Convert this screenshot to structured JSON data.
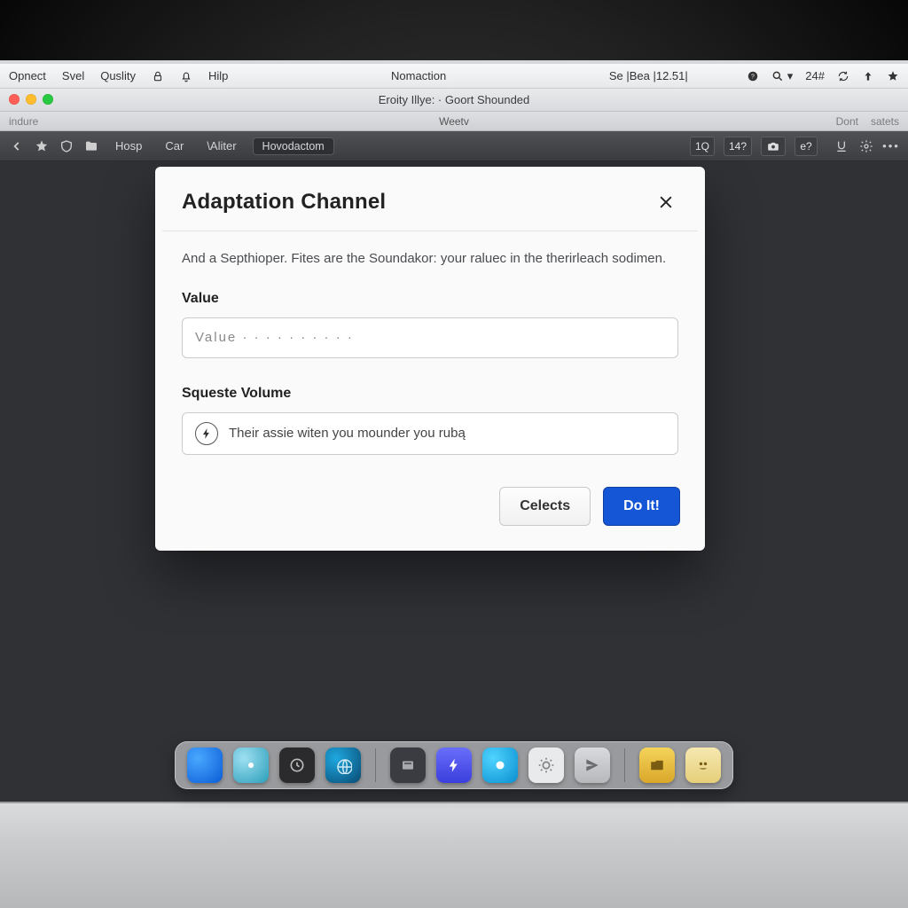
{
  "menubar": {
    "items": [
      "Opnect",
      "Svel",
      "Quslity",
      "Hilp"
    ],
    "center": "Nomaction",
    "status": "Se |Bea |12.51|",
    "clock": "24#"
  },
  "window": {
    "title": "Eroity Illye: · Goort Shounded",
    "subtitle": "Weetv",
    "sub_left": "indure",
    "sub_right": [
      "Dont",
      "satets"
    ]
  },
  "toolbar": {
    "items": [
      "Hosp",
      "Car",
      "\\Aliter"
    ],
    "pill": "Hovodactom",
    "chips": [
      "1Q",
      "14?",
      "e?"
    ]
  },
  "modal": {
    "title": "Adaptation Channel",
    "description": "And a Septhioper. Fites are the Soundakor: your raluec in the therirleach sodimen.",
    "field1_label": "Value",
    "field1_placeholder": "Value · · · · · · · · · ·",
    "field2_label": "Squeste Volume",
    "field2_text": "Their assie witen you mounder you rubą",
    "cancel": "Celects",
    "confirm": "Do It!"
  }
}
